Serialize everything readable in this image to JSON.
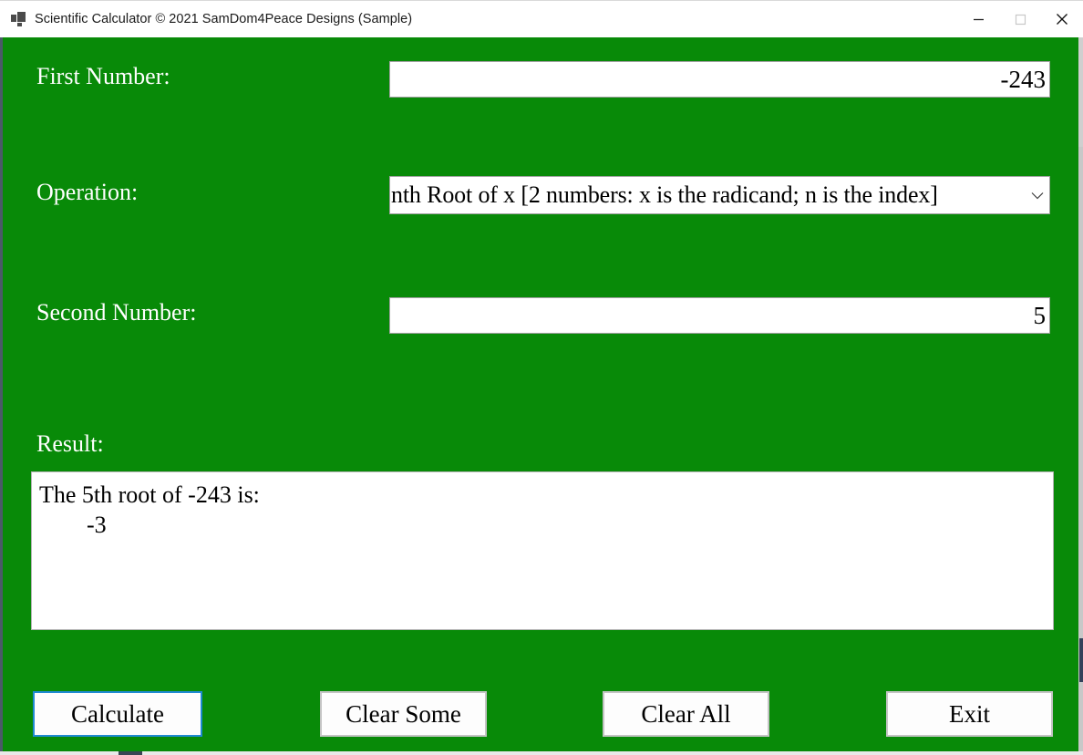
{
  "window": {
    "title": "Scientific Calculator © 2021 SamDom4Peace Designs (Sample)",
    "app_icon": "app-squares-icon",
    "background_color": "#088a08",
    "controls": {
      "minimize": "minimize-icon",
      "maximize": "maximize-icon",
      "close": "close-icon"
    }
  },
  "form": {
    "first_number": {
      "label": "First Number:",
      "value": "-243",
      "placeholder": ""
    },
    "operation": {
      "label": "Operation:",
      "selected": "nth Root of x [2 numbers: x is the radicand; n is the index]",
      "arrow_icon": "chevron-down-icon",
      "options": [
        "nth Root of x [2 numbers: x is the radicand; n is the index]"
      ]
    },
    "second_number": {
      "label": "Second Number:",
      "value": "5",
      "placeholder": ""
    },
    "result": {
      "label": "Result:",
      "line1": "The 5th root of -243 is:",
      "line2": "",
      "line3": "        -3"
    }
  },
  "buttons": {
    "calculate": "Calculate",
    "clear_some": "Clear Some",
    "clear_all": "Clear All",
    "exit": "Exit",
    "focus_color": "#1f8ad2"
  }
}
